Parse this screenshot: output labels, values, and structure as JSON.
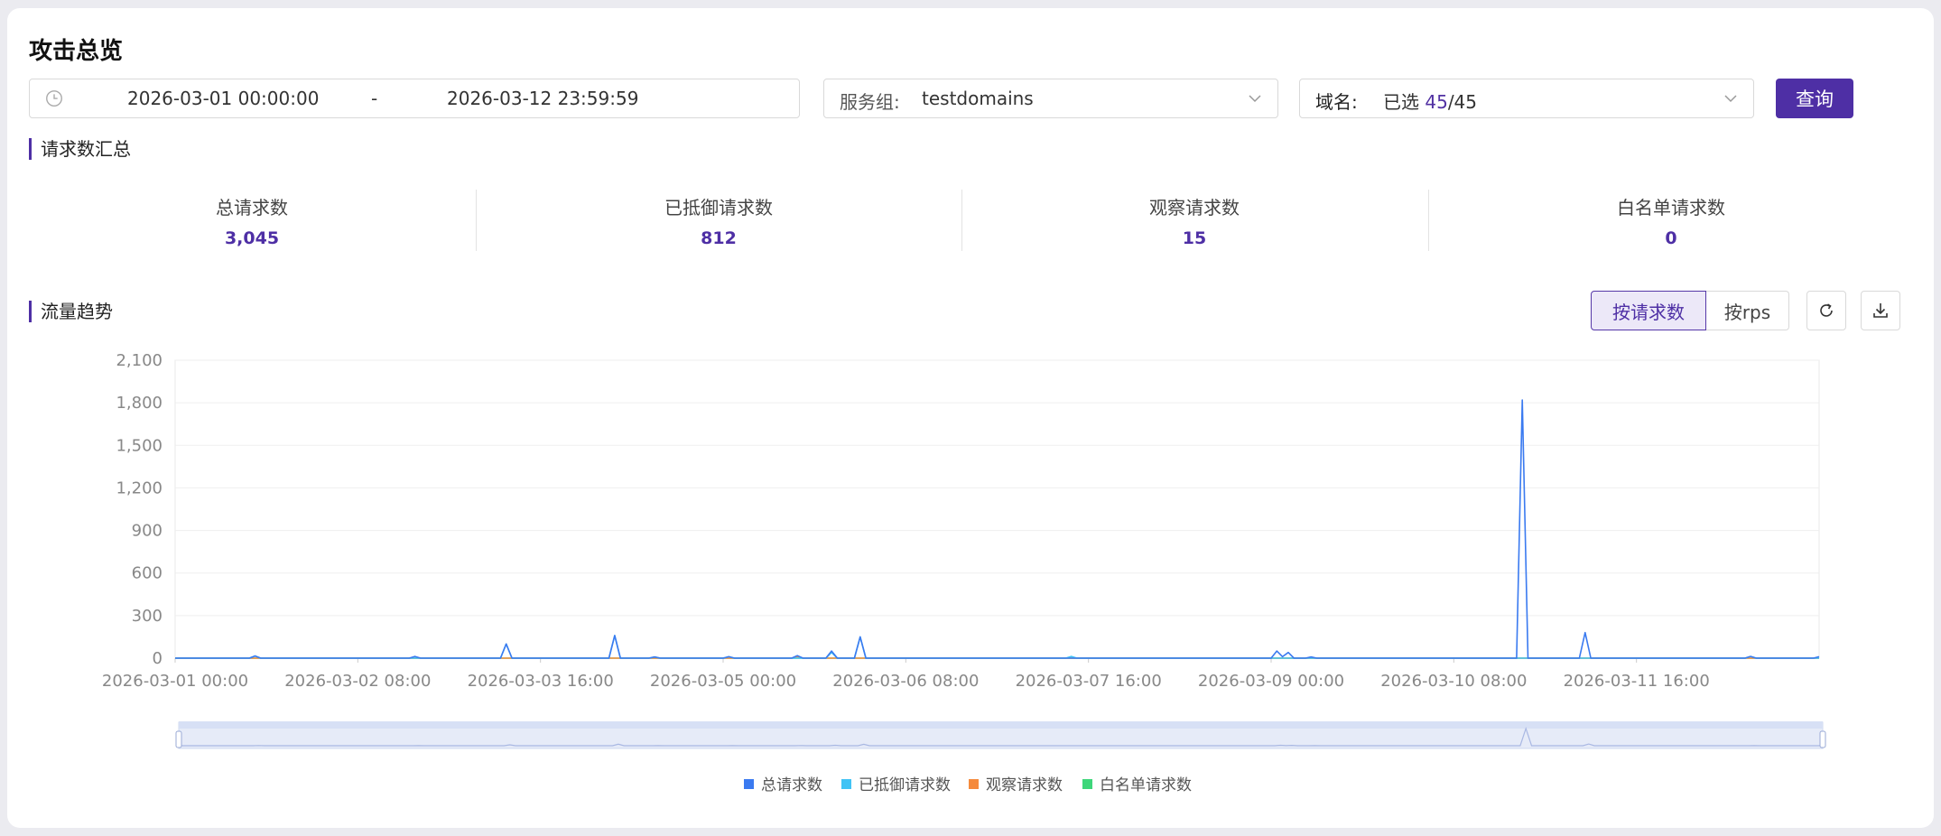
{
  "page": {
    "title": "攻击总览"
  },
  "filters": {
    "date_start": "2026-03-01 00:00:00",
    "date_sep": "-",
    "date_end": "2026-03-12 23:59:59",
    "service_group_label": "服务组:",
    "service_group_value": "testdomains",
    "domain_label": "域名:",
    "domain_prefix": "已选 ",
    "domain_selected": "45",
    "domain_total": "/45",
    "query_button": "查询"
  },
  "summary": {
    "section_title": "请求数汇总",
    "stats": [
      {
        "label": "总请求数",
        "value": "3,045"
      },
      {
        "label": "已抵御请求数",
        "value": "812"
      },
      {
        "label": "观察请求数",
        "value": "15"
      },
      {
        "label": "白名单请求数",
        "value": "0"
      }
    ]
  },
  "trend": {
    "section_title": "流量趋势",
    "toggle": {
      "by_requests": "按请求数",
      "by_rps": "按rps",
      "active": "by_requests"
    },
    "icons": {
      "refresh": "refresh-icon",
      "download": "download-icon"
    }
  },
  "colors": {
    "accent": "#4e2fa5",
    "total": "#3a7af0",
    "blocked": "#41c3f5",
    "observed": "#f58a3c",
    "whitelist": "#3ed67a"
  },
  "chart_data": {
    "type": "line",
    "x_range_hours": [
      0,
      288
    ],
    "x_tick_labels": [
      "2026-03-01 00:00",
      "2026-03-02 08:00",
      "2026-03-03 16:00",
      "2026-03-05 00:00",
      "2026-03-06 08:00",
      "2026-03-07 16:00",
      "2026-03-09 00:00",
      "2026-03-10 08:00",
      "2026-03-11 16:00"
    ],
    "ylim": [
      0,
      2100
    ],
    "y_ticks": [
      0,
      300,
      600,
      900,
      1200,
      1500,
      1800,
      2100
    ],
    "y_tick_labels": [
      "0",
      "300",
      "600",
      "900",
      "1,200",
      "1,500",
      "1,800",
      "2,100"
    ],
    "legend_position": "bottom",
    "series": [
      {
        "name": "总请求数",
        "color": "#3a7af0",
        "points": [
          [
            0,
            0
          ],
          [
            13,
            0
          ],
          [
            14,
            15
          ],
          [
            15,
            0
          ],
          [
            41,
            0
          ],
          [
            42,
            12
          ],
          [
            43,
            0
          ],
          [
            57,
            0
          ],
          [
            58,
            100
          ],
          [
            59,
            0
          ],
          [
            76,
            0
          ],
          [
            77,
            160
          ],
          [
            78,
            0
          ],
          [
            83,
            0
          ],
          [
            84,
            8
          ],
          [
            85,
            0
          ],
          [
            96,
            0
          ],
          [
            97,
            10
          ],
          [
            98,
            0
          ],
          [
            108,
            0
          ],
          [
            109,
            18
          ],
          [
            110,
            0
          ],
          [
            114,
            0
          ],
          [
            115,
            50
          ],
          [
            116,
            0
          ],
          [
            119,
            0
          ],
          [
            120,
            150
          ],
          [
            121,
            0
          ],
          [
            192,
            0
          ],
          [
            193,
            50
          ],
          [
            194,
            10
          ],
          [
            195,
            40
          ],
          [
            196,
            0
          ],
          [
            198,
            0
          ],
          [
            199,
            8
          ],
          [
            200,
            0
          ],
          [
            235,
            0
          ],
          [
            236,
            1820
          ],
          [
            237,
            0
          ],
          [
            246,
            0
          ],
          [
            247,
            180
          ],
          [
            248,
            0
          ],
          [
            275,
            0
          ],
          [
            276,
            12
          ],
          [
            277,
            0
          ],
          [
            287,
            0
          ],
          [
            288,
            10
          ]
        ]
      },
      {
        "name": "已抵御请求数",
        "color": "#41c3f5",
        "points": [
          [
            0,
            0
          ],
          [
            13,
            0
          ],
          [
            14,
            15
          ],
          [
            15,
            0
          ],
          [
            57,
            0
          ],
          [
            58,
            100
          ],
          [
            59,
            0
          ],
          [
            76,
            0
          ],
          [
            77,
            160
          ],
          [
            78,
            0
          ],
          [
            83,
            0
          ],
          [
            84,
            8
          ],
          [
            85,
            0
          ],
          [
            96,
            0
          ],
          [
            97,
            10
          ],
          [
            98,
            0
          ],
          [
            114,
            0
          ],
          [
            115,
            40
          ],
          [
            116,
            0
          ],
          [
            119,
            0
          ],
          [
            120,
            150
          ],
          [
            121,
            0
          ],
          [
            156,
            0
          ],
          [
            157,
            12
          ],
          [
            158,
            0
          ],
          [
            275,
            0
          ],
          [
            276,
            12
          ],
          [
            277,
            0
          ],
          [
            288,
            0
          ]
        ]
      },
      {
        "name": "观察请求数",
        "color": "#f58a3c",
        "points": [
          [
            0,
            0
          ],
          [
            108,
            0
          ],
          [
            109,
            10
          ],
          [
            110,
            0
          ],
          [
            288,
            0
          ]
        ]
      },
      {
        "name": "白名单请求数",
        "color": "#3ed67a",
        "points": [
          [
            0,
            0
          ],
          [
            288,
            0
          ]
        ]
      }
    ]
  }
}
